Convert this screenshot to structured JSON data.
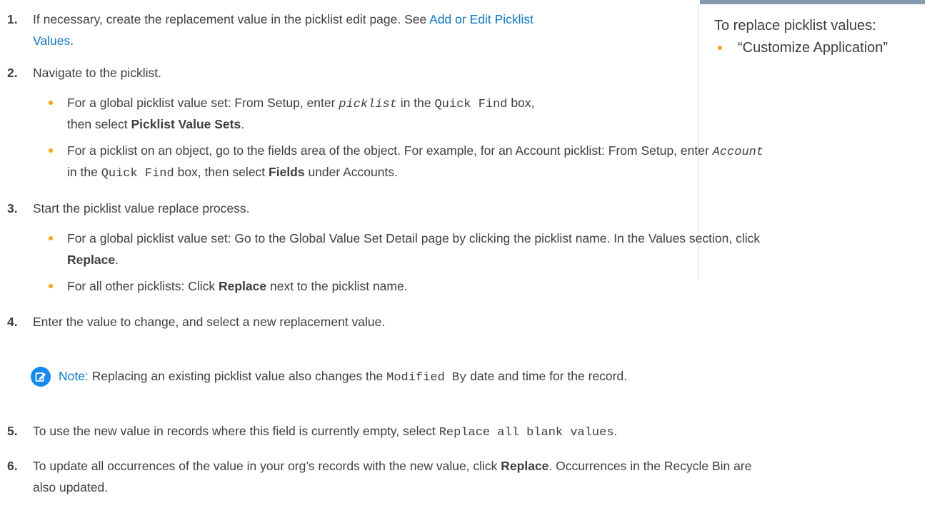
{
  "steps": [
    {
      "number": "1.",
      "line1": "If necessary, create the replacement value in the picklist edit page. See ",
      "link_part1": "Add or Edit Picklist",
      "link_part2": "Values",
      "tail": "."
    },
    {
      "number": "2.",
      "text": "Navigate to the picklist."
    },
    {
      "number": "3.",
      "text": "Start the picklist value replace process."
    },
    {
      "number": "4.",
      "text": "Enter the value to change, and select a new replacement value."
    },
    {
      "number": "5.",
      "pre": "To use the new value in records where this field is currently empty, select ",
      "code": "Replace all blank values",
      "post": "."
    },
    {
      "number": "6.",
      "pre": "To update all occurrences of the value in your org’s records with the new value, click ",
      "bold": "Replace",
      "post": ". Occurrences in the Recycle Bin are",
      "line2": "also updated."
    }
  ],
  "step2_bullets": [
    {
      "pre": "For a global picklist value set: From Setup, enter ",
      "code_italic": "picklist",
      "mid": " in the ",
      "code": "Quick Find",
      "post": " box,",
      "line2_pre": "then select ",
      "line2_bold": "Picklist Value Sets",
      "line2_post": "."
    },
    {
      "pre": "For a picklist on an object, go to the fields area of the object. For example, for an Account picklist: From Setup, enter ",
      "code_italic": "Account",
      "line2_pre": "in the ",
      "line2_code": "Quick Find",
      "line2_mid": " box, then select ",
      "line2_bold": "Fields",
      "line2_post": " under Accounts."
    }
  ],
  "step3_bullets": [
    {
      "pre": "For a global picklist value set: Go to the Global Value Set Detail page by clicking the picklist name. In the Values section, click",
      "line2_bold": "Replace",
      "line2_post": "."
    },
    {
      "pre": "For all other picklists: Click ",
      "bold": "Replace",
      "post": " next to the picklist name."
    }
  ],
  "note": {
    "label": "Note:",
    "pre": " Replacing an existing picklist value also changes the ",
    "code": "Modified By",
    "post": " date and time for the record."
  },
  "sidebar": {
    "heading": "To replace picklist values:",
    "permission": "“Customize Application”"
  },
  "colors": {
    "bullet": "#f0a810",
    "link": "#0f78c4",
    "note_icon": "#1589ee",
    "sidebar_bar": "#8799ad"
  }
}
